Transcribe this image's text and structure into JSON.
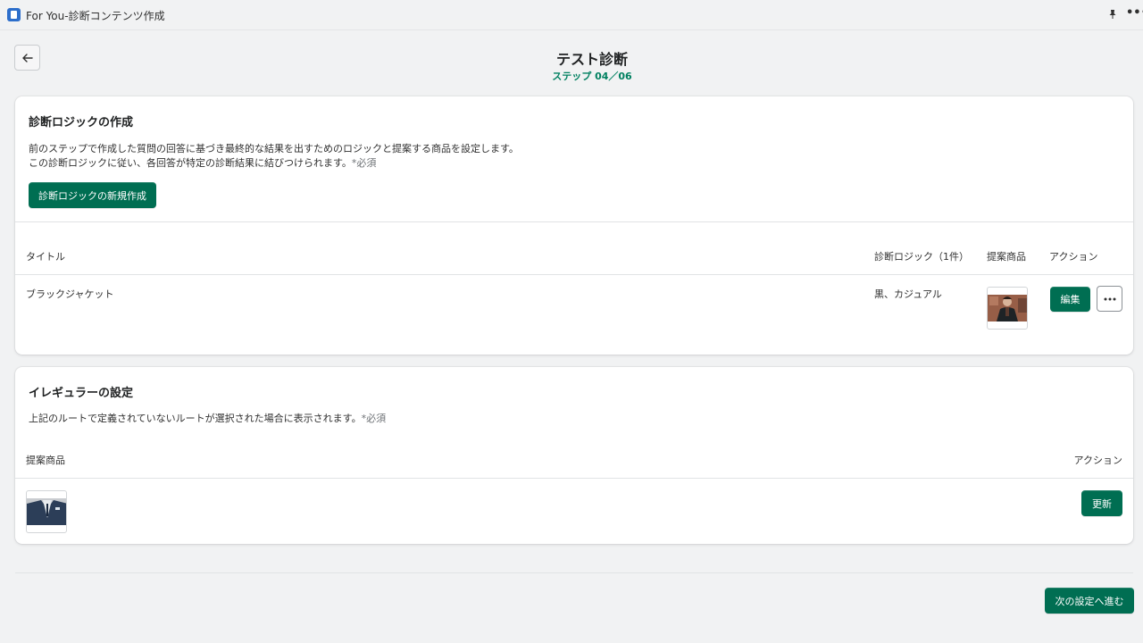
{
  "window": {
    "title": "For You-診断コンテンツ作成"
  },
  "header": {
    "title": "テスト診断",
    "step": "ステップ 04／06"
  },
  "logic_section": {
    "heading": "診断ロジックの作成",
    "description_line1": "前のステップで作成した質問の回答に基づき最終的な結果を出すためのロジックと提案する商品を設定します。",
    "description_line2": "この診断ロジックに従い、各回答が特定の診断結果に結びつけられます。",
    "required_mark": "*必須",
    "create_button": "診断ロジックの新規作成",
    "columns": {
      "title": "タイトル",
      "logic": "診断ロジック（1件）",
      "product": "提案商品",
      "action": "アクション"
    },
    "rows": [
      {
        "title": "ブラックジャケット",
        "logic": "黒、カジュアル",
        "edit_label": "編集"
      }
    ]
  },
  "irregular_section": {
    "heading": "イレギュラーの設定",
    "description": "上記のルートで定義されていないルートが選択された場合に表示されます。",
    "required_mark": "*必須",
    "columns": {
      "product": "提案商品",
      "action": "アクション"
    },
    "update_button": "更新"
  },
  "footer": {
    "next_button": "次の設定へ進む"
  },
  "colors": {
    "primary": "#006e52",
    "step_text": "#008060",
    "background": "#f1f2f3"
  }
}
